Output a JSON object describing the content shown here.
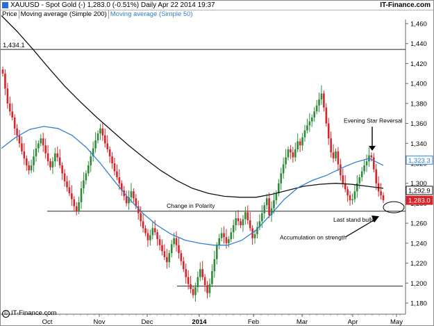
{
  "header": {
    "title": "XAUUSD - Spot Gold (-)    1,283.0 (-0.51%)    Daily  Apr 22 2014 19:37",
    "brand": "IT-Finance.com"
  },
  "legend": {
    "price": "Price",
    "ma200": "Moving average (Simple 200)",
    "ma50": "Moving average (Simple 50)"
  },
  "copyright": "IT-Finance.com",
  "chart_data": {
    "type": "candlestick",
    "x_ticks": [
      "Oct",
      "Nov",
      "Dec",
      "2014",
      "Feb",
      "Mar",
      "Apr",
      "May"
    ],
    "y_ticks": [
      "1,460",
      "1,440",
      "1,420",
      "1,400",
      "1,380",
      "1,360",
      "1,340",
      "1,320",
      "1,300",
      "1,280",
      "1,260",
      "1,240",
      "1,220",
      "1,200",
      "1,180"
    ],
    "ylim": [
      1172,
      1472
    ],
    "levels": [
      1434.1,
      1272,
      1197
    ],
    "price_labels": [
      {
        "text": "1,434.1",
        "value": 1434.1,
        "style": "plain"
      },
      {
        "text": "1,323.3",
        "value": 1323.3,
        "style": "blue"
      },
      {
        "text": "1,292.9",
        "value": 1292.9,
        "style": "black"
      },
      {
        "text": "1,283.0",
        "value": 1283.0,
        "style": "red"
      }
    ],
    "ohlc_closes": [
      1410,
      1395,
      1380,
      1372,
      1366,
      1355,
      1348,
      1340,
      1332,
      1325,
      1318,
      1313,
      1318,
      1327,
      1335,
      1340,
      1345,
      1338,
      1330,
      1322,
      1316,
      1322,
      1330,
      1326,
      1318,
      1310,
      1302,
      1296,
      1290,
      1284,
      1277,
      1272,
      1281,
      1295,
      1303,
      1310,
      1318,
      1327,
      1335,
      1343,
      1350,
      1355,
      1348,
      1340,
      1334,
      1327,
      1320,
      1312,
      1306,
      1300,
      1293,
      1287,
      1280,
      1286,
      1292,
      1285,
      1277,
      1270,
      1262,
      1255,
      1250,
      1243,
      1248,
      1255,
      1251,
      1244,
      1238,
      1232,
      1226,
      1221,
      1230,
      1239,
      1245,
      1238,
      1230,
      1222,
      1214,
      1206,
      1199,
      1194,
      1188,
      1196,
      1206,
      1214,
      1206,
      1198,
      1190,
      1199,
      1212,
      1224,
      1238,
      1245,
      1250,
      1246,
      1240,
      1244,
      1251,
      1258,
      1265,
      1262,
      1258,
      1264,
      1271,
      1263,
      1255,
      1245,
      1249,
      1256,
      1262,
      1270,
      1278,
      1285,
      1268,
      1275,
      1283,
      1290,
      1300,
      1310,
      1319,
      1326,
      1334,
      1331,
      1326,
      1334,
      1342,
      1338,
      1346,
      1353,
      1358,
      1362,
      1366,
      1372,
      1378,
      1384,
      1390,
      1376,
      1360,
      1345,
      1331,
      1325,
      1332,
      1319,
      1308,
      1300,
      1294,
      1288,
      1283,
      1284,
      1292,
      1300,
      1306,
      1312,
      1318,
      1322,
      1328,
      1326,
      1314,
      1300,
      1292,
      1288,
      1283
    ],
    "ma200_values": [
      1468,
      1452,
      1434,
      1415,
      1397,
      1381,
      1366,
      1352,
      1338,
      1325,
      1313,
      1303,
      1295,
      1290,
      1287,
      1286,
      1286,
      1289,
      1293,
      1297,
      1299,
      1300,
      1299,
      1297,
      1295
    ],
    "ma50_values": [
      1335,
      1346,
      1354,
      1357,
      1355,
      1348,
      1336,
      1320,
      1302,
      1285,
      1270,
      1258,
      1249,
      1243,
      1240,
      1238,
      1238,
      1243,
      1253,
      1268,
      1284,
      1296,
      1303,
      1308,
      1315,
      1321,
      1325,
      1318
    ],
    "annotations": [
      {
        "text": "Evening Star Reversal",
        "value": 1363
      },
      {
        "text": "Change in Polarity",
        "value": 1274
      },
      {
        "text": "Last stand bulls",
        "value": 1263
      },
      {
        "text": "Accumulation on strength",
        "value": 1245
      }
    ],
    "colors": {
      "up": "#2e8b3a",
      "down": "#d8232a",
      "ma50": "#2f7fd1",
      "ma200": "#111111",
      "grid": "#d0d0d0"
    }
  }
}
